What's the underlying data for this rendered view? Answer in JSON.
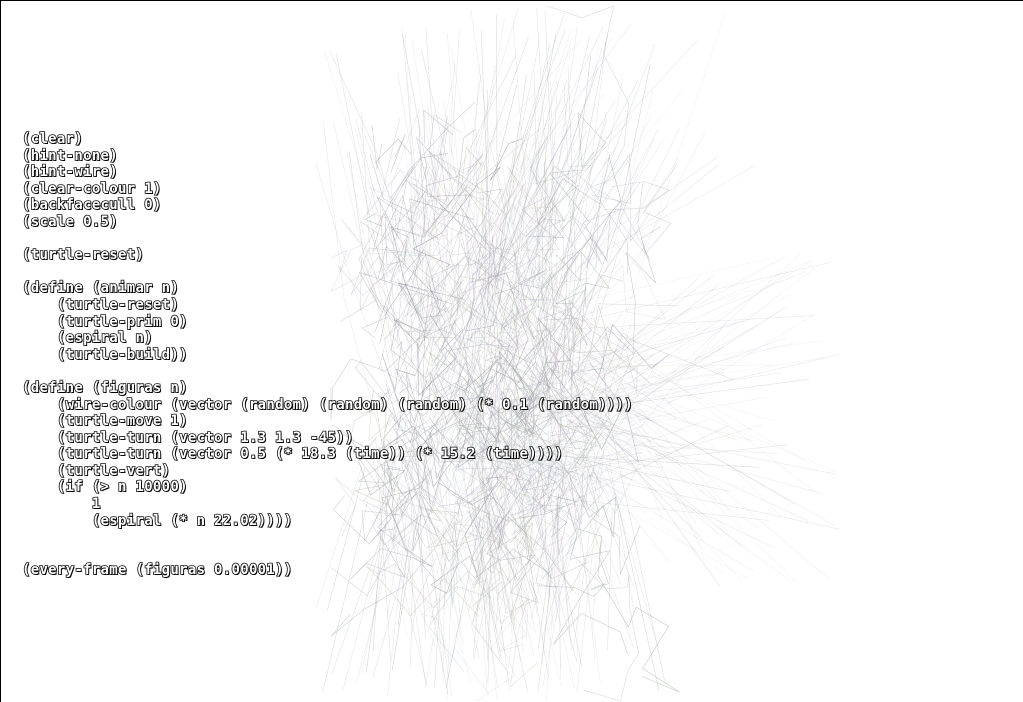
{
  "editor": {
    "lines": [
      "(clear)",
      "(hint-none)",
      "(hint-wire)",
      "(clear-colour 1)",
      "(backfacecull 0)",
      "(scale 0.5)",
      "",
      "(turtle-reset)",
      "",
      "(define (animar n)",
      "    (turtle-reset)",
      "    (turtle-prim 0)",
      "    (espiral n)",
      "    (turtle-build))",
      "",
      "(define (figuras n)",
      "    (wire-colour (vector (random) (random) (random) (* 0.1 (random))))",
      "    (turtle-move 1)",
      "    (turtle-turn (vector 1.3 1.3 -45))",
      "    (turtle-turn (vector 0.5 (* 18.3 (time)) (* 15.2 (time))))",
      "    (turtle-vert)",
      "    (if (> n 10000)",
      "        1",
      "        (espiral (* n 22.02))))",
      "",
      "",
      "(every-frame (figuras 0.00001))"
    ]
  },
  "scene": {
    "background_colour": "#ffffff",
    "wire_palette": [
      "#b9b3bf",
      "#a7b3a5",
      "#c4b8c9",
      "#9aa5a0",
      "#bdc8d0",
      "#8e8a94",
      "#c9c2b4",
      "#a6a0b8"
    ]
  }
}
